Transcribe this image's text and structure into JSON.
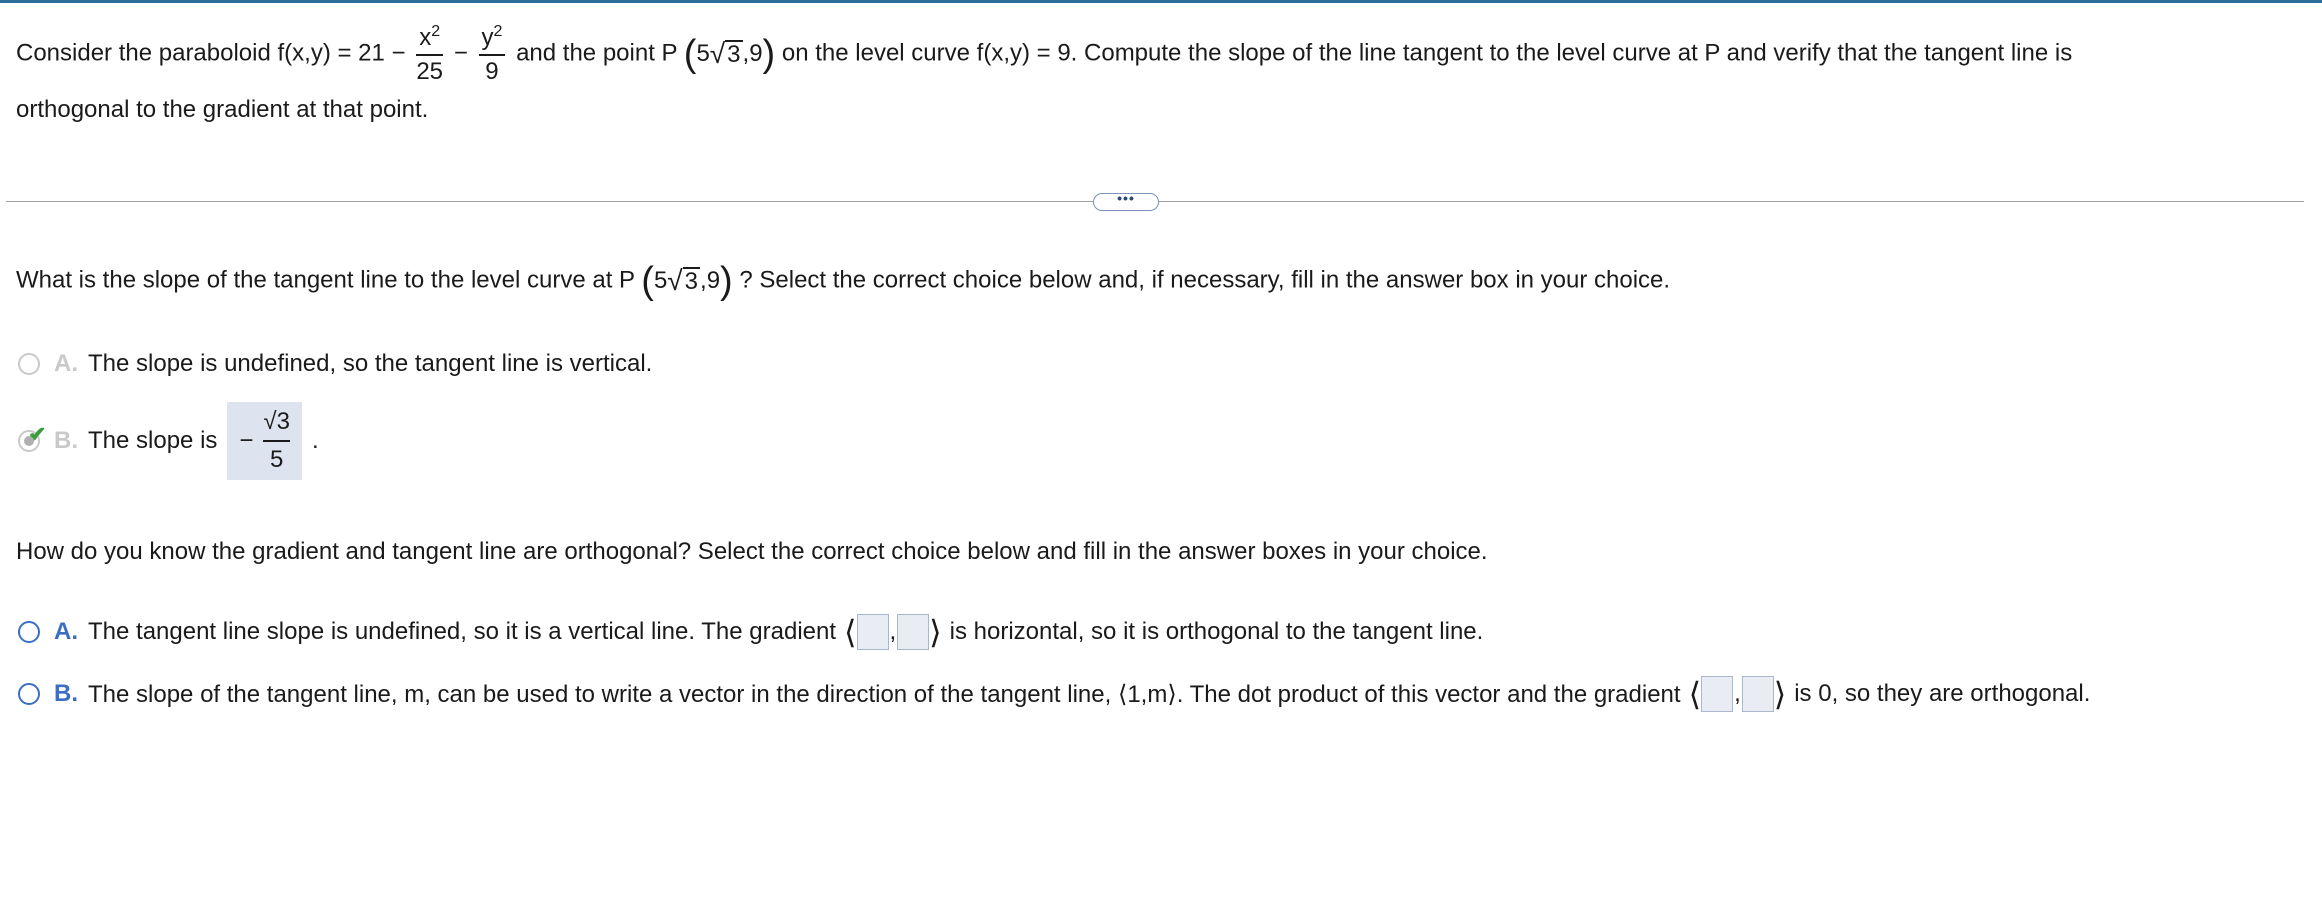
{
  "problem": {
    "intro": "Consider the paraboloid f(x,y) = 21 −",
    "frac1_num": "x",
    "frac1_den": "25",
    "minus": "−",
    "frac2_num": "y",
    "frac2_den": "9",
    "exp": "2",
    "mid": "and the point P",
    "point_left": "5",
    "point_radicand": "3",
    "point_right": ",9",
    "after": "on the level curve f(x,y) = 9. Compute the slope of the line tangent to the level curve at P and verify that the tangent line is",
    "line2": "orthogonal to the gradient at that point."
  },
  "more_button": "•••",
  "question1": {
    "before": "What is the slope of the tangent line to the level curve at P",
    "after": "? Select the correct choice below and, if necessary, fill in the answer box in your choice.",
    "choices": [
      {
        "letter": "A.",
        "text": "The slope is undefined, so the tangent line is vertical."
      },
      {
        "letter": "B.",
        "text": "The slope is",
        "answer_sign": "−",
        "answer_num": "√3",
        "answer_den": "5",
        "tail": "."
      }
    ]
  },
  "question2": {
    "text": "How do you know the gradient and tangent line are orthogonal? Select the correct choice below and fill in the answer boxes in your choice.",
    "choices": [
      {
        "letter": "A.",
        "text_before": "The tangent line slope is undefined, so it is a vertical line. The gradient",
        "text_after": "is horizontal, so it is orthogonal to the tangent line."
      },
      {
        "letter": "B.",
        "text_before": "The slope of the tangent line, m, can be used to write a vector in the direction of the tangent line, ⟨1,m⟩. The dot product of this vector and the gradient",
        "text_after": "is 0, so they are orthogonal."
      }
    ]
  },
  "colors": {
    "accent": "#3c6fc4",
    "answer_bg": "#dde3ef",
    "check": "#3a9d3a",
    "topbar": "#2f6d9a"
  }
}
